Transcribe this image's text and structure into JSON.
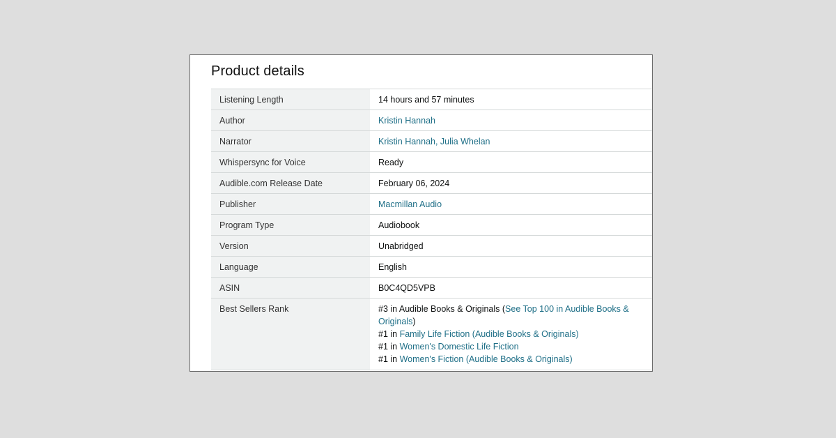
{
  "title": "Product details",
  "rows": [
    {
      "label": "Listening Length",
      "value": "14 hours and 57 minutes",
      "link": false
    },
    {
      "label": "Author",
      "value": "Kristin Hannah",
      "link": true
    },
    {
      "label": "Narrator",
      "value": "Kristin Hannah, Julia Whelan",
      "link": true
    },
    {
      "label": "Whispersync for Voice",
      "value": "Ready",
      "link": false
    },
    {
      "label": "Audible.com Release Date",
      "value": "February 06, 2024",
      "link": false
    },
    {
      "label": "Publisher",
      "value": "Macmillan Audio",
      "link": true
    },
    {
      "label": "Program Type",
      "value": "Audiobook",
      "link": false
    },
    {
      "label": "Version",
      "value": "Unabridged",
      "link": false
    },
    {
      "label": "Language",
      "value": "English",
      "link": false
    },
    {
      "label": "ASIN",
      "value": "B0C4QD5VPB",
      "link": false
    }
  ],
  "best_sellers": {
    "label": "Best Sellers Rank",
    "primary": {
      "prefix": "#3 in Audible Books & Originals (",
      "link": "See Top 100 in Audible Books & Originals",
      "suffix": ")"
    },
    "ranks": [
      {
        "prefix": "#1 in ",
        "link": "Family Life Fiction (Audible Books & Originals)"
      },
      {
        "prefix": "#1 in ",
        "link": "Women's Domestic Life Fiction"
      },
      {
        "prefix": "#1 in ",
        "link": "Women's Fiction (Audible Books & Originals)"
      }
    ]
  },
  "colors": {
    "link": "#1f6f87",
    "label_bg": "#f0f2f2",
    "page_bg": "#dedede"
  }
}
